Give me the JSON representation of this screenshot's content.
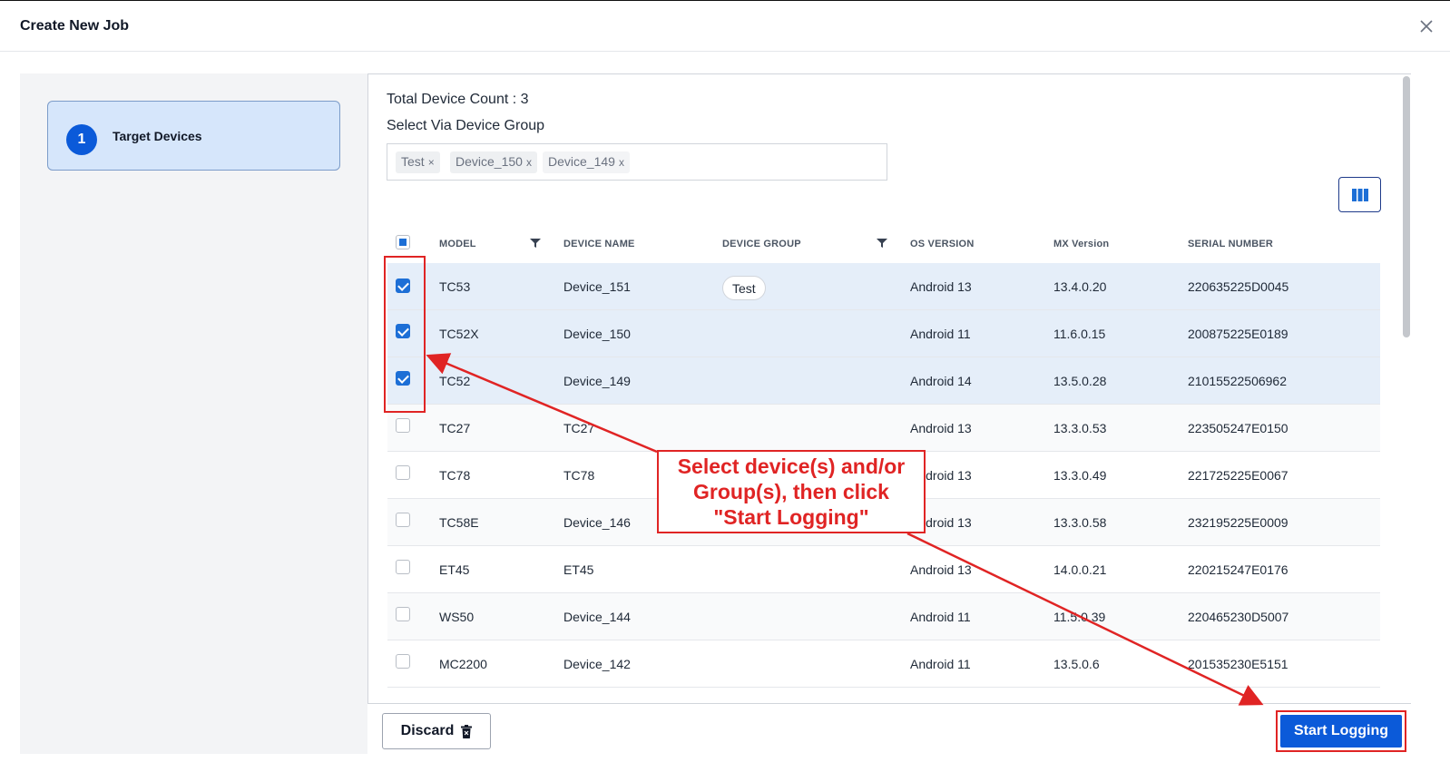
{
  "dialog": {
    "title": "Create New Job"
  },
  "steps": [
    {
      "number": "1",
      "label": "Target Devices"
    }
  ],
  "main": {
    "total_count": "Total Device Count : 3",
    "group_label": "Select Via Device Group",
    "group_tags": [
      {
        "label": "Test",
        "remove": "×"
      },
      {
        "label": "Device_150",
        "remove": "x"
      },
      {
        "label": "Device_149",
        "remove": "x"
      }
    ]
  },
  "table": {
    "columns": [
      "MODEL",
      "DEVICE NAME",
      "DEVICE GROUP",
      "OS VERSION",
      "MX Version",
      "SERIAL NUMBER"
    ],
    "rows": [
      {
        "checked": true,
        "model": "TC53",
        "name": "Device_151",
        "group": "Test",
        "os": "Android 13",
        "mx": "13.4.0.20",
        "serial": "220635225D0045"
      },
      {
        "checked": true,
        "model": "TC52X",
        "name": "Device_150",
        "group": "",
        "os": "Android 11",
        "mx": "11.6.0.15",
        "serial": "200875225E0189"
      },
      {
        "checked": true,
        "model": "TC52",
        "name": "Device_149",
        "group": "",
        "os": "Android 14",
        "mx": "13.5.0.28",
        "serial": "21015522506962"
      },
      {
        "checked": false,
        "model": "TC27",
        "name": "TC27",
        "group": "",
        "os": "Android 13",
        "mx": "13.3.0.53",
        "serial": "223505247E0150"
      },
      {
        "checked": false,
        "model": "TC78",
        "name": "TC78",
        "group": "",
        "os": "Android 13",
        "mx": "13.3.0.49",
        "serial": "221725225E0067"
      },
      {
        "checked": false,
        "model": "TC58E",
        "name": "Device_146",
        "group": "",
        "os": "Android 13",
        "mx": "13.3.0.58",
        "serial": "232195225E0009"
      },
      {
        "checked": false,
        "model": "ET45",
        "name": "ET45",
        "group": "",
        "os": "Android 13",
        "mx": "14.0.0.21",
        "serial": "220215247E0176"
      },
      {
        "checked": false,
        "model": "WS50",
        "name": "Device_144",
        "group": "",
        "os": "Android 11",
        "mx": "11.5.0.39",
        "serial": "220465230D5007"
      },
      {
        "checked": false,
        "model": "MC2200",
        "name": "Device_142",
        "group": "",
        "os": "Android 11",
        "mx": "13.5.0.6",
        "serial": "201535230E5151"
      }
    ]
  },
  "footer": {
    "discard_label": "Discard",
    "start_label": "Start Logging"
  },
  "annotation": {
    "text": "Select device(s) and/or\nGroup(s), then click\n\"Start Logging\""
  },
  "colors": {
    "accent": "#0b5ad9",
    "annotation": "#e02424",
    "selected_row": "#e5eef9"
  },
  "icons": [
    "close-icon",
    "column-chooser-icon",
    "filter-icon",
    "trash-icon"
  ]
}
